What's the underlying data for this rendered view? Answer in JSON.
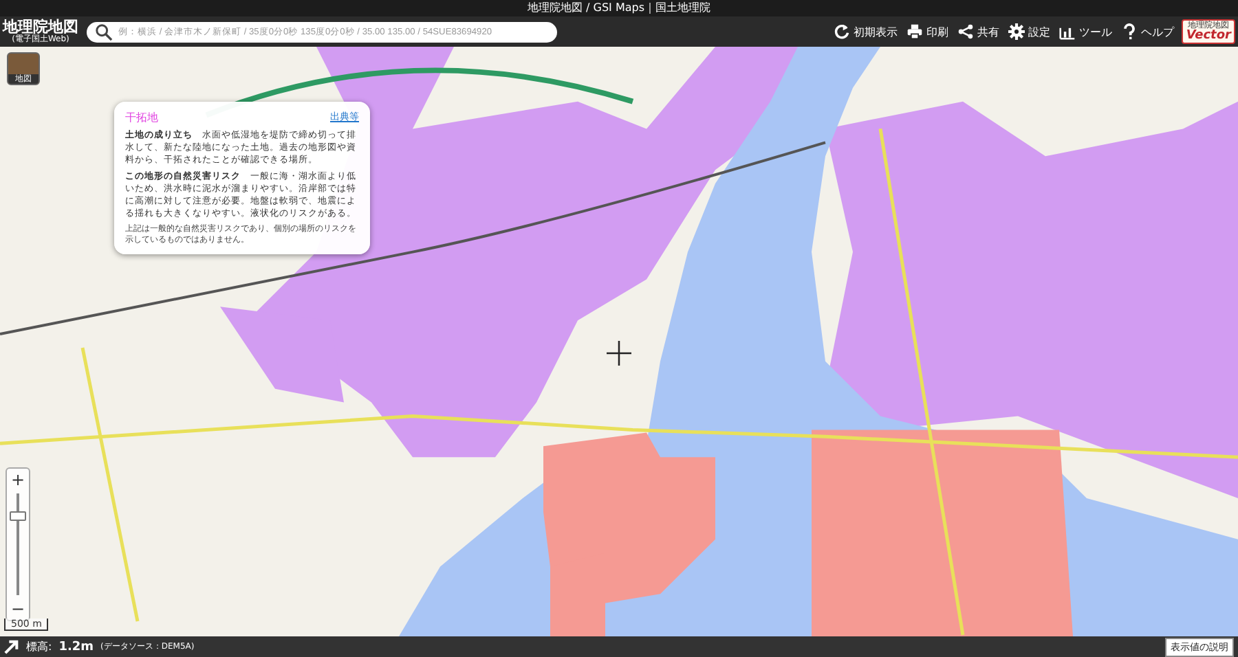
{
  "window": {
    "title": "地理院地図 / GSI Maps｜国土地理院"
  },
  "header": {
    "logo_title": "地理院地図",
    "logo_subtitle": "(電子国土Web)",
    "search": {
      "placeholder": "例：横浜 / 会津市木ノ新保町 / 35度0分0秒 135度0分0秒 / 35.00 135.00 / 54SUE83694920"
    },
    "tools": [
      {
        "kind": "reset",
        "label": "初期表示"
      },
      {
        "kind": "print",
        "label": "印刷"
      },
      {
        "kind": "share",
        "label": "共有"
      },
      {
        "kind": "settings",
        "label": "設定"
      },
      {
        "kind": "tool",
        "label": "ツール"
      },
      {
        "kind": "help",
        "label": "ヘルプ"
      }
    ],
    "vector_badge": {
      "top": "地理院地図",
      "bottom": "Vector"
    }
  },
  "map": {
    "layer_button": {
      "label": "地図"
    },
    "popup": {
      "title": "干拓地",
      "source_link": "出典等",
      "paragraphs": [
        "**土地の成り立ち**　水面や低湿地を堤防で締め切って排水して、新たな陸地になった土地。過去の地形図や資料から、干拓されたことが確認できる場所。",
        "**この地形の自然災害リスク**　一般に海・湖水面より低いため、洪水時に泥水が溜まりやすい。沿岸部では特に高潮に対して注意が必要。地盤は軟弱で、地震による揺れも大きくなりやすい。液状化のリスクがある。"
      ],
      "note": "上記は一般的な自然災害リスクであり、個別の場所のリスクを示しているものではありません。"
    },
    "zoom": {
      "plus": "+",
      "minus": "−",
      "level": 0.78
    },
    "scale": "500 m"
  },
  "status_bar": {
    "label": "標高:",
    "value": "1.2m",
    "source": "(データソース：DEM5A)",
    "button": "表示値の説明"
  }
}
